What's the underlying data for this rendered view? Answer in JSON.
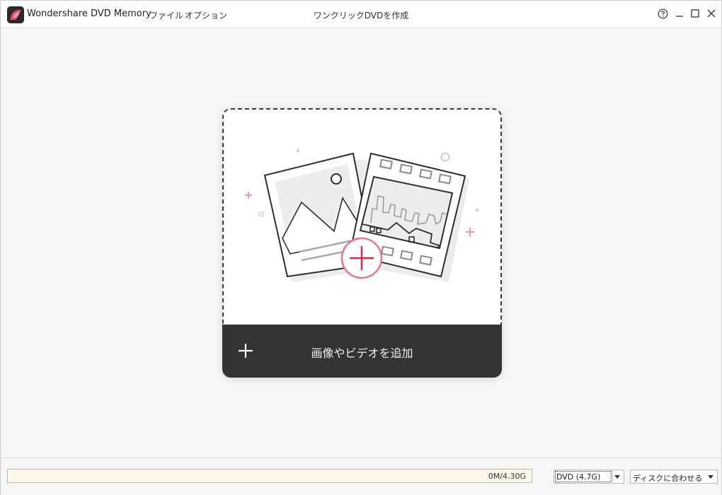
{
  "titlebar": {
    "app_title": "Wondershare DVD Memory",
    "menu": {
      "file": "ファイル",
      "options": "オプション"
    },
    "window_caption": "ワンクリックDVDを作成",
    "controls": [
      "help-icon",
      "minimize-icon",
      "maximize-icon",
      "close-icon"
    ]
  },
  "drop_zone": {
    "add_label": "画像やビデオを追加",
    "accent_color": "#e8758d"
  },
  "status": {
    "usage_text": "0M/4.30G",
    "usage_fraction": 0,
    "disc_type": "DVD (4.7G)",
    "fit_option": "ディスクに合わせる"
  }
}
